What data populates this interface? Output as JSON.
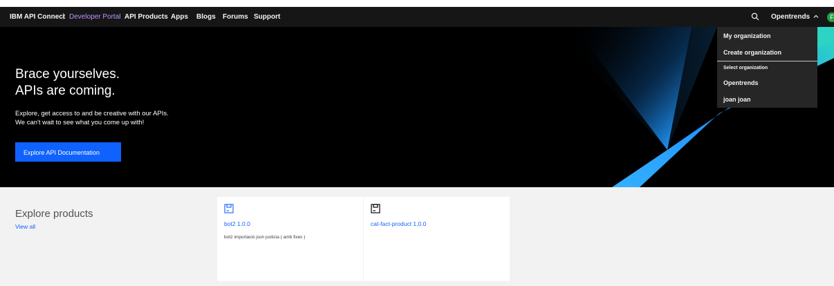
{
  "navbar": {
    "brand": "IBM API Connect",
    "separator": "|",
    "portal": "Developer Portal",
    "links": [
      "API Products",
      "Apps",
      "Blogs",
      "Forums",
      "Support"
    ],
    "search_icon": "search-icon",
    "org_name": "Opentrends",
    "chevron_icon": "chevron-up-icon",
    "avatar_initial": "F"
  },
  "dropdown": {
    "my_org": "My organization",
    "create_org": "Create organization",
    "select_header": "Select organization",
    "orgs": [
      "Opentrends",
      "joan joan"
    ]
  },
  "hero": {
    "title_line1": "Brace yourselves.",
    "title_line2": "APIs are coming.",
    "desc_line1": "Explore, get access to and be creative with our APIs.",
    "desc_line2": "We can't wait to see what you come up with!",
    "button": "Explore API Documentation"
  },
  "products": {
    "title": "Explore products",
    "view_all": "View all",
    "cards": [
      {
        "name": "bot2 1.0.0",
        "description": "bot2 importació json justicia ( amb fixes )",
        "icon": "product-icon"
      },
      {
        "name": "cat-fact-product 1.0.0",
        "description": "",
        "icon": "product-icon"
      }
    ]
  },
  "colors": {
    "navbar_bg": "#161616",
    "portal_accent": "#be95ff",
    "primary_button": "#0f62fe",
    "link": "#0f62fe",
    "hero_bg": "#000000",
    "dropdown_bg": "#262626"
  }
}
